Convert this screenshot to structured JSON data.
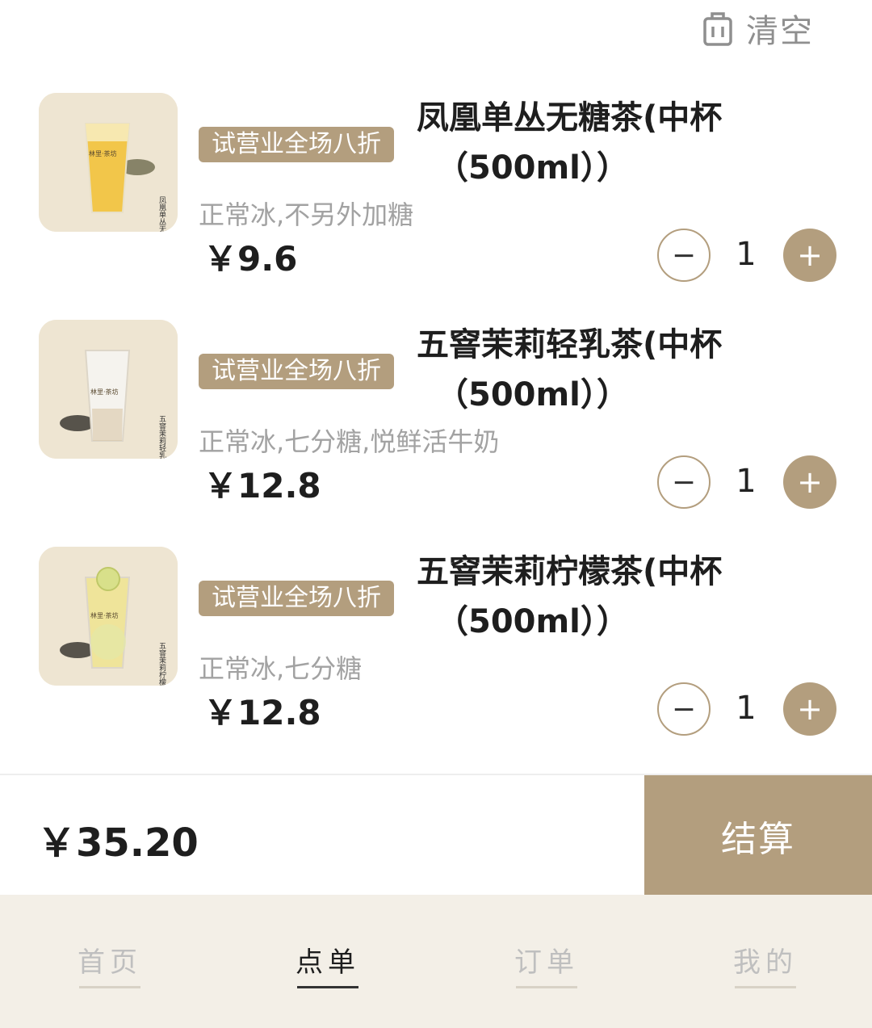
{
  "header": {
    "clear_label": "清空"
  },
  "items": [
    {
      "badge": "试营业全场八折",
      "title_line1": "凤凰单丛无糖茶(中杯",
      "title_line2": "（500ml））",
      "spec": "正常冰,不另外加糖",
      "price": "￥9.6",
      "quantity": "1",
      "image_label": "凤凰单丛无糖茶",
      "brand": "林里·茶坊"
    },
    {
      "badge": "试营业全场八折",
      "title_line1": "五窨茉莉轻乳茶(中杯",
      "title_line2": "（500ml））",
      "spec": "正常冰,七分糖,悦鲜活牛奶",
      "price": "￥12.8",
      "quantity": "1",
      "image_label": "五窨茉莉轻乳茶",
      "brand": "林里·茶坊"
    },
    {
      "badge": "试营业全场八折",
      "title_line1": "五窨茉莉柠檬茶(中杯",
      "title_line2": "（500ml））",
      "spec": "正常冰,七分糖",
      "price": "￥12.8",
      "quantity": "1",
      "image_label": "五窨茉莉柠檬茶",
      "brand": "林里·茶坊"
    }
  ],
  "stepper": {
    "minus": "−",
    "plus": "+"
  },
  "checkout": {
    "total": "￥35.20",
    "button_label": "结算"
  },
  "tabs": [
    {
      "label": "首页",
      "active": false
    },
    {
      "label": "点单",
      "active": true
    },
    {
      "label": "订单",
      "active": false
    },
    {
      "label": "我的",
      "active": false
    }
  ],
  "colors": {
    "accent": "#b39e7e",
    "tabbar_bg": "#f3efe7",
    "thumb_bg": "#eee5d2"
  },
  "icons": {
    "clear": "trash-icon"
  }
}
